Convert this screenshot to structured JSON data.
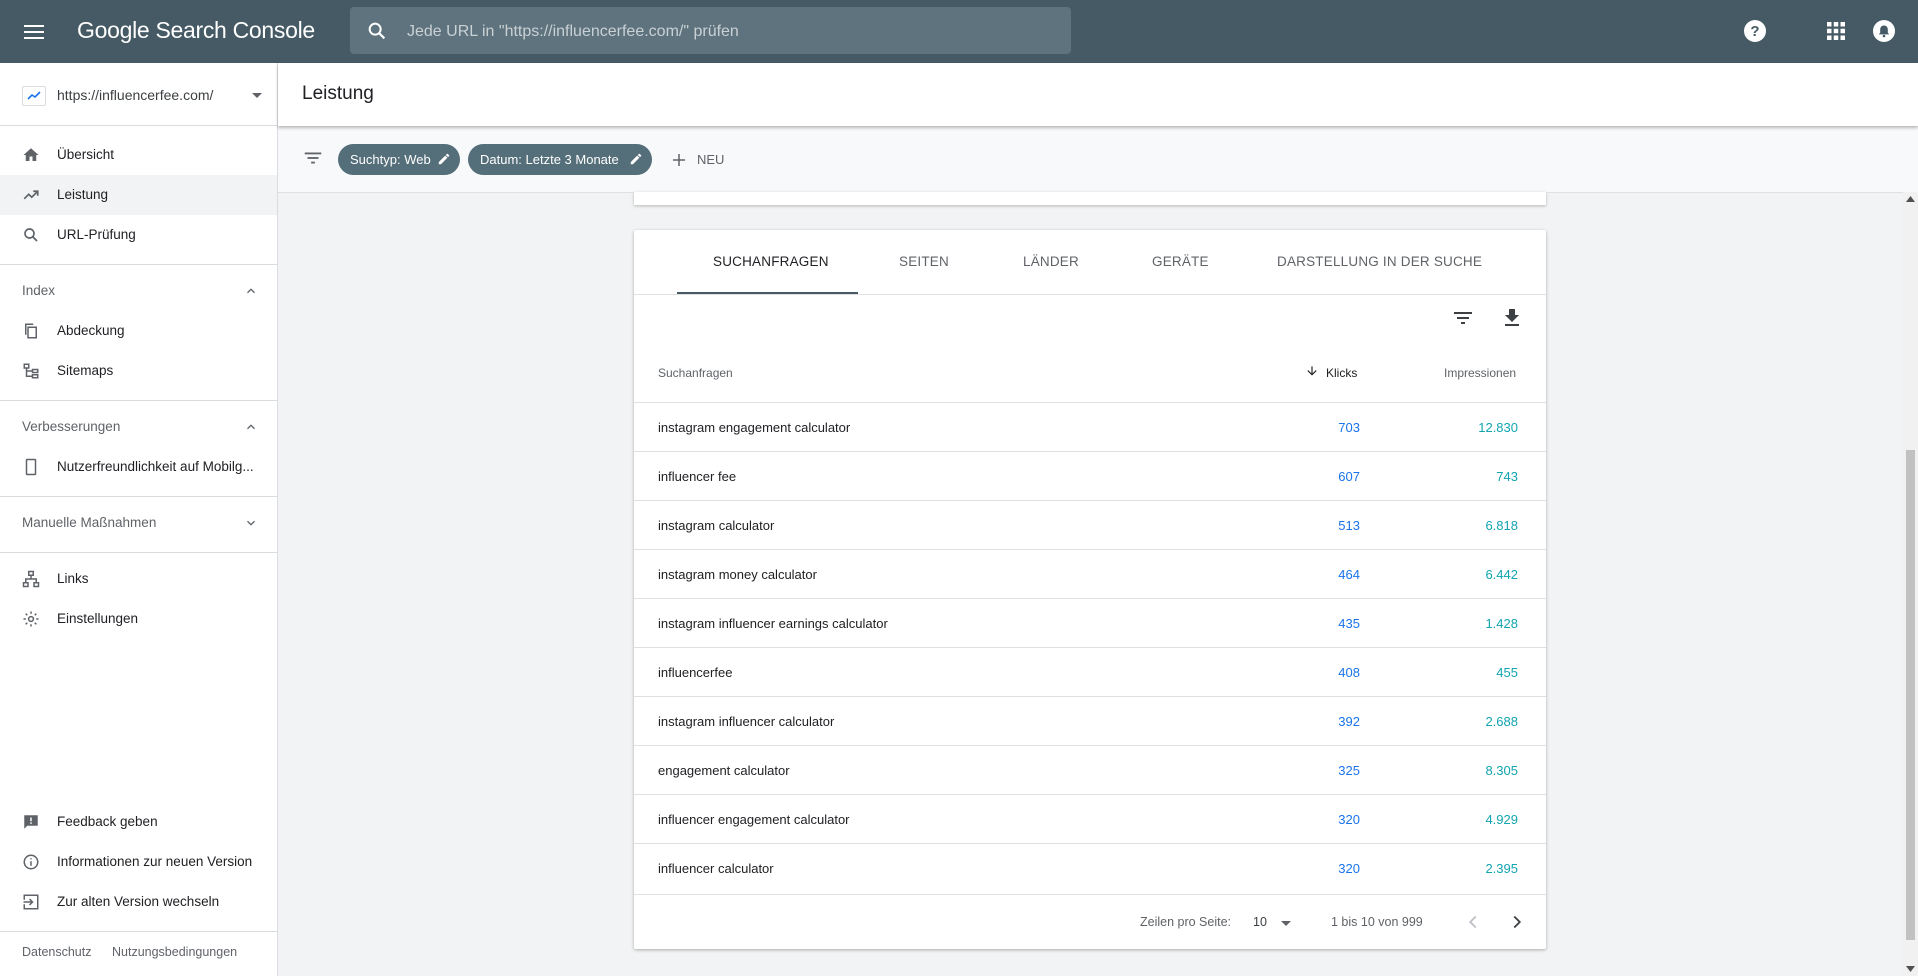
{
  "app": {
    "title": "Google Search Console"
  },
  "search": {
    "placeholder": "Jede URL in \"https://influencerfee.com/\" prüfen"
  },
  "property": {
    "url": "https://influencerfee.com/"
  },
  "sidebar": {
    "main": [
      {
        "label": "Übersicht",
        "icon": "home-icon"
      },
      {
        "label": "Leistung",
        "icon": "trending-up-icon",
        "active": true
      },
      {
        "label": "URL-Prüfung",
        "icon": "search-icon"
      }
    ],
    "index": {
      "title": "Index",
      "items": [
        {
          "label": "Abdeckung"
        },
        {
          "label": "Sitemaps"
        }
      ]
    },
    "improvements": {
      "title": "Verbesserungen",
      "items": [
        {
          "label": "Nutzerfreundlichkeit auf Mobilg..."
        }
      ]
    },
    "manual": {
      "title": "Manuelle Maßnahmen"
    },
    "other": [
      {
        "label": "Links"
      },
      {
        "label": "Einstellungen"
      }
    ],
    "bottom": [
      {
        "label": "Feedback geben"
      },
      {
        "label": "Informationen zur neuen Version"
      },
      {
        "label": "Zur alten Version wechseln"
      }
    ],
    "footer": {
      "privacy": "Datenschutz",
      "terms": "Nutzungsbedingungen"
    }
  },
  "header": {
    "title": "Leistung"
  },
  "filters": {
    "search_type": "Suchtyp: Web",
    "date": "Datum: Letzte 3 Monate",
    "new_label": "NEU"
  },
  "tabs": [
    "SUCHANFRAGEN",
    "SEITEN",
    "LÄNDER",
    "GERÄTE",
    "DARSTELLUNG IN DER SUCHE"
  ],
  "table": {
    "headers": {
      "query": "Suchanfragen",
      "clicks": "Klicks",
      "impressions": "Impressionen"
    },
    "rows": [
      {
        "query": "instagram engagement calculator",
        "clicks": "703",
        "impressions": "12.830"
      },
      {
        "query": "influencer fee",
        "clicks": "607",
        "impressions": "743"
      },
      {
        "query": "instagram calculator",
        "clicks": "513",
        "impressions": "6.818"
      },
      {
        "query": "instagram money calculator",
        "clicks": "464",
        "impressions": "6.442"
      },
      {
        "query": "instagram influencer earnings calculator",
        "clicks": "435",
        "impressions": "1.428"
      },
      {
        "query": "influencerfee",
        "clicks": "408",
        "impressions": "455"
      },
      {
        "query": "instagram influencer calculator",
        "clicks": "392",
        "impressions": "2.688"
      },
      {
        "query": "engagement calculator",
        "clicks": "325",
        "impressions": "8.305"
      },
      {
        "query": "influencer engagement calculator",
        "clicks": "320",
        "impressions": "4.929"
      },
      {
        "query": "influencer calculator",
        "clicks": "320",
        "impressions": "2.395"
      }
    ]
  },
  "pagination": {
    "rows_label": "Zeilen pro Seite:",
    "rows_value": "10",
    "range": "1 bis 10 von 999"
  },
  "colors": {
    "topbar": "#455a64",
    "chip": "#546e7a",
    "clicks": "#1a73e8",
    "impressions": "#12a4af"
  }
}
